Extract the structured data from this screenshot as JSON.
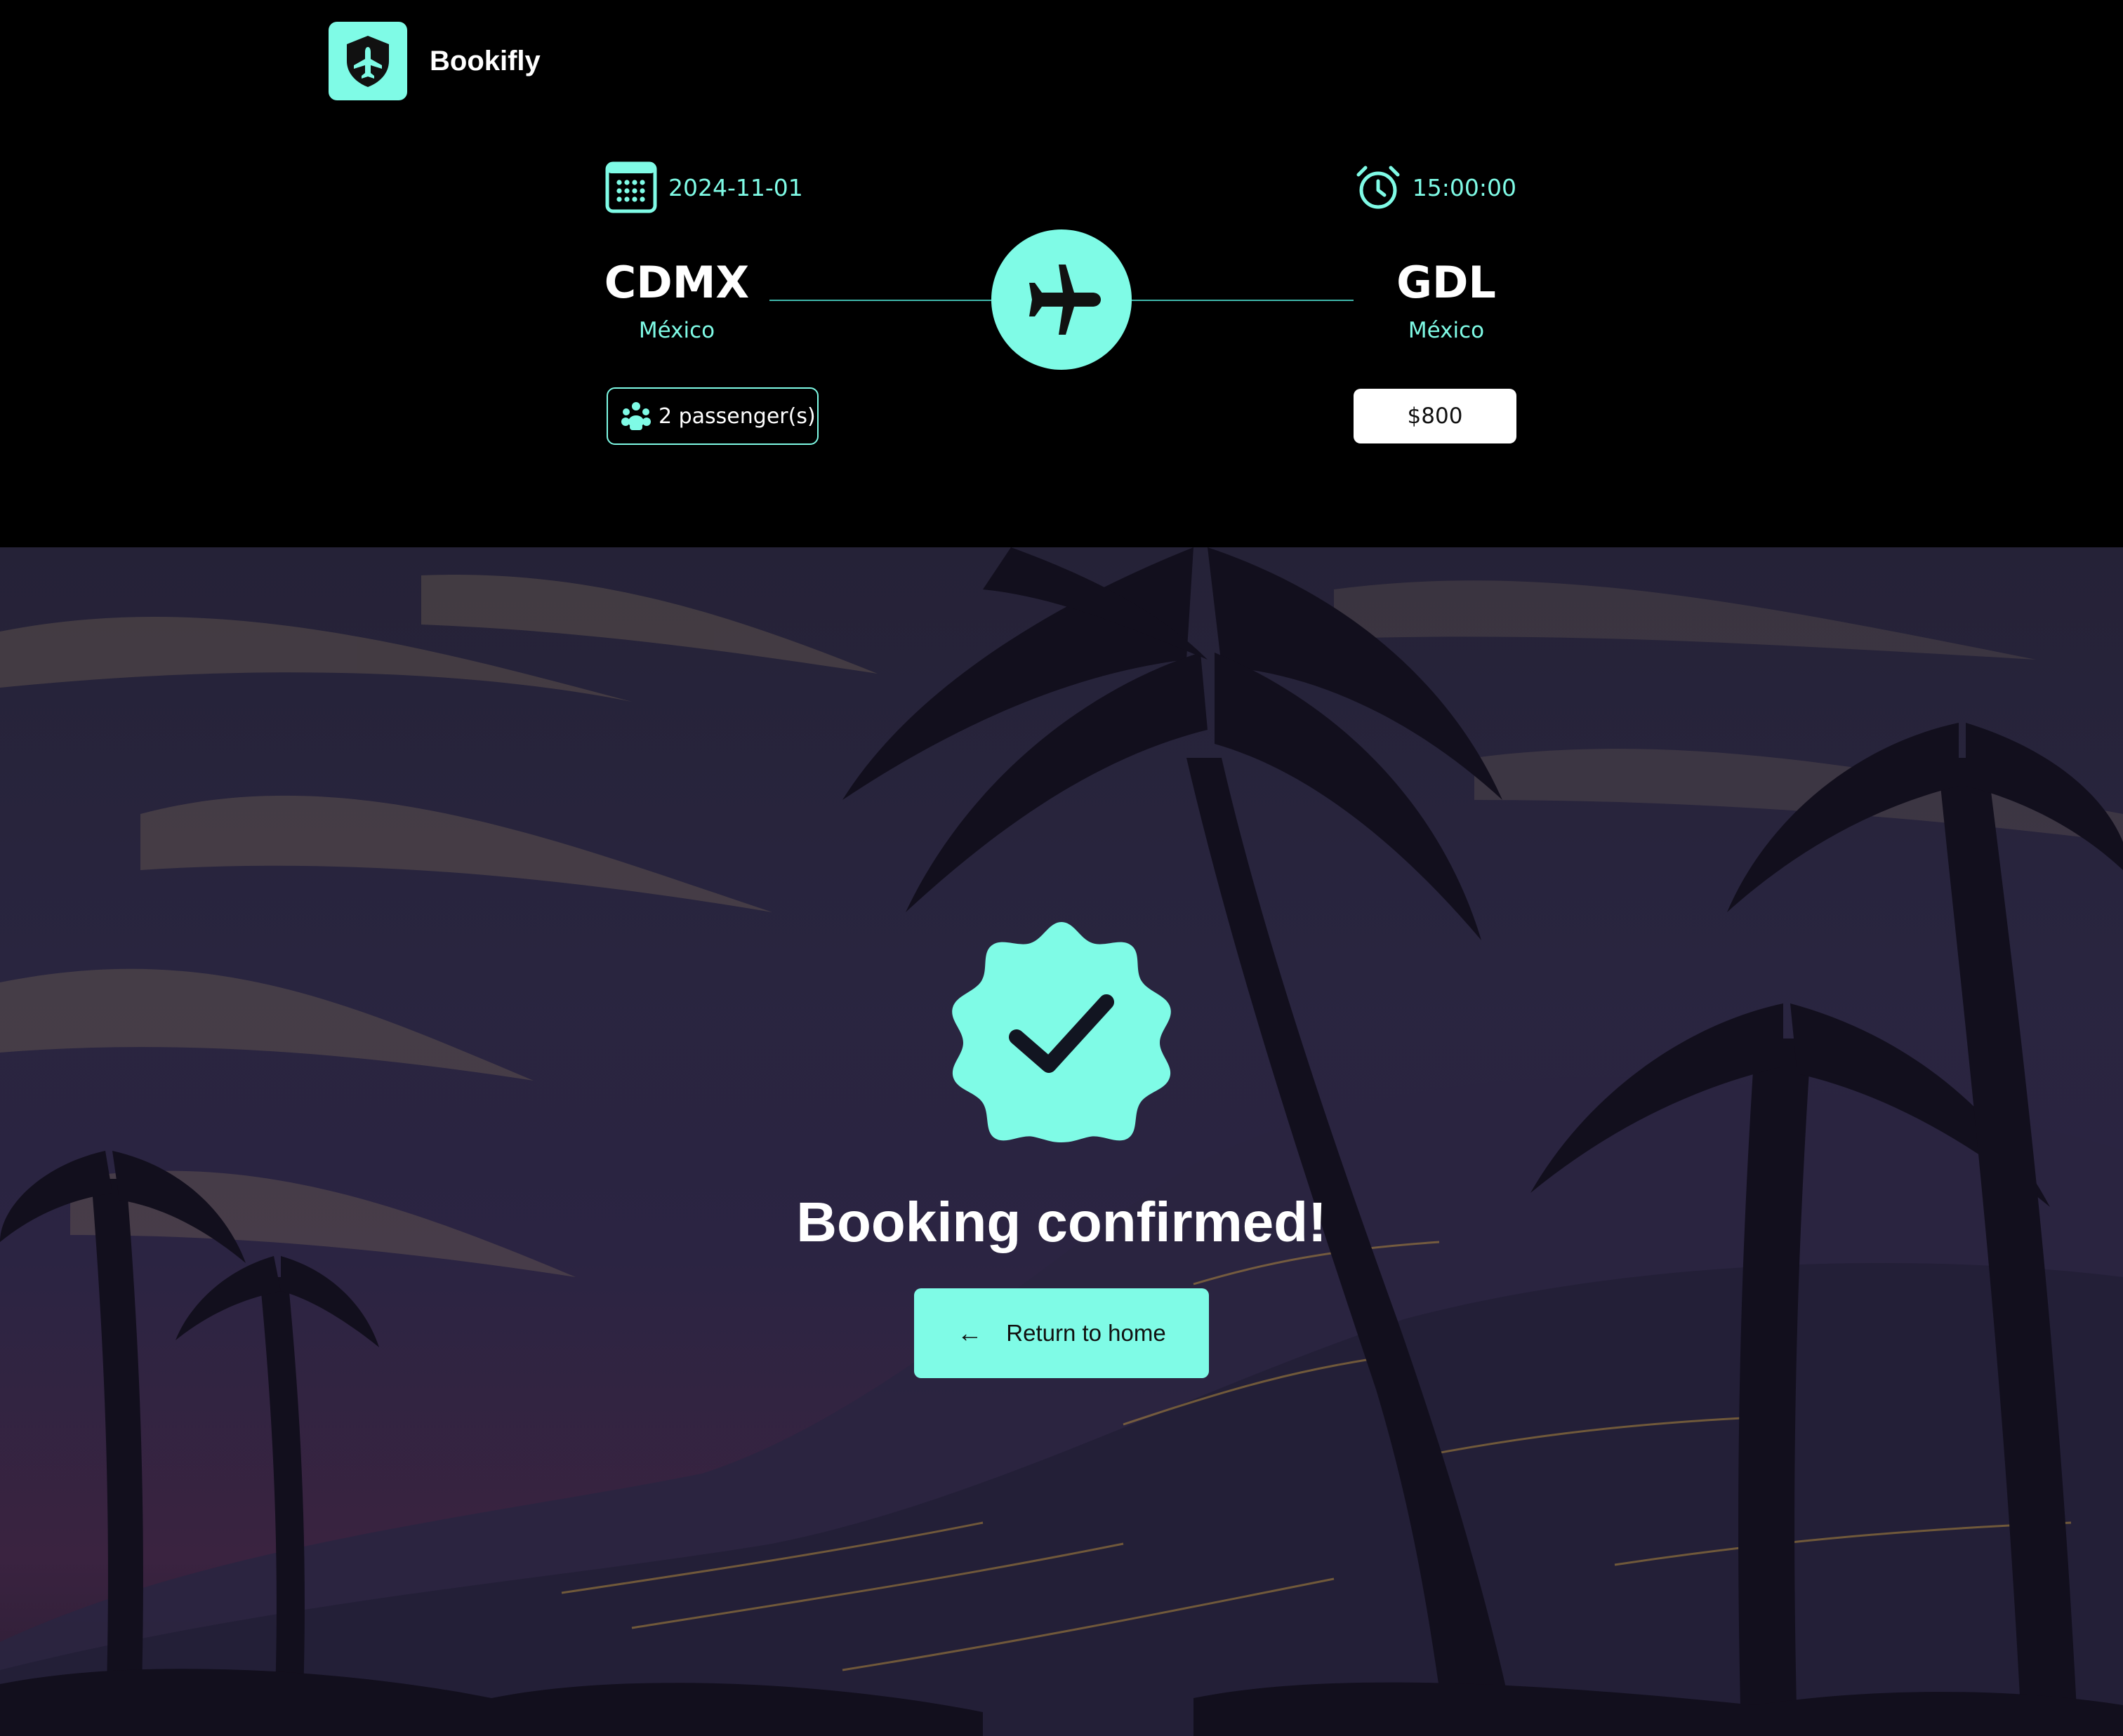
{
  "brand": {
    "name": "Bookifly",
    "accent": "#7ffbe6"
  },
  "flight": {
    "date": "2024-11-01",
    "time": "15:00:00",
    "origin": {
      "code": "CDMX",
      "country": "México"
    },
    "destination": {
      "code": "GDL",
      "country": "México"
    },
    "passengers": "2 passenger(s)",
    "price": "$800"
  },
  "confirmation": {
    "title": "Booking confirmed!",
    "button_label": "Return to home"
  },
  "icons": {
    "logo": "shield-plane-icon",
    "date": "calendar-icon",
    "time": "alarm-clock-icon",
    "route": "plane-icon",
    "passengers": "group-icon",
    "confirmation": "verified-check-icon",
    "back": "arrow-left-icon"
  }
}
